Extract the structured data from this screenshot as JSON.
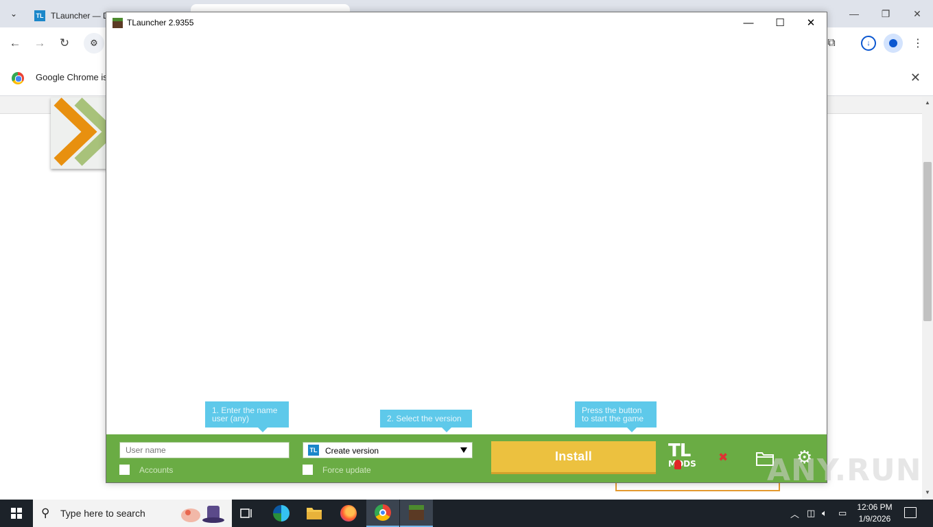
{
  "browser": {
    "tabs": [
      {
        "label": "TLauncher — D"
      },
      {
        "label": ""
      }
    ],
    "infobar_text": "Google Chrome is",
    "window_controls": {
      "minimize": "—",
      "restore": "❐",
      "close": "✕"
    }
  },
  "tlauncher": {
    "title": "TLauncher 2.9355",
    "hints": {
      "name_line1": "1. Enter the name",
      "name_line2": "user (any)",
      "version": "2. Select the version",
      "start_line1": "Press the button",
      "start_line2": "to start the game"
    },
    "username_placeholder": "User name",
    "accounts_label": "Accounts",
    "version_select_value": "Create version",
    "force_update_label": "Force update",
    "install_label": "Install",
    "tlmods_top": "TL",
    "tlmods_bottom": "MODS"
  },
  "watermark": "ANY.RUN",
  "taskbar": {
    "search_placeholder": "Type here to search",
    "time": "12:06 PM",
    "date": "1/9/2026"
  },
  "colors": {
    "launcher_green": "#6aac44",
    "install_yellow": "#ecc13f",
    "hint_blue": "#5ec9ea"
  }
}
